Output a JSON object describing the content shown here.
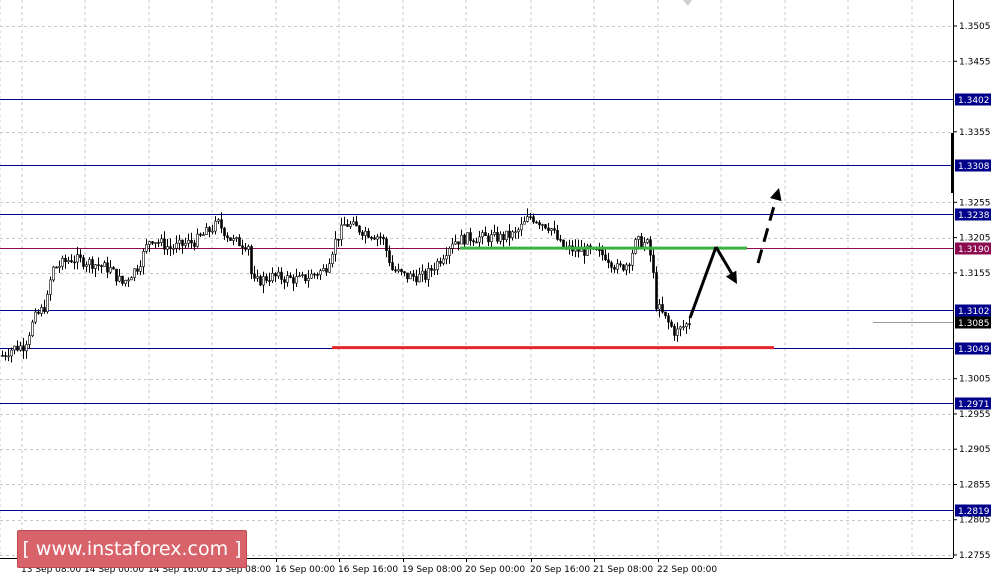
{
  "chart_data": {
    "type": "candlestick",
    "instrument_note": "",
    "y_axis": {
      "ylim": [
        1.2745,
        1.3525
      ],
      "ticks": [
        "1.3505",
        "1.3455",
        "1.3355",
        "1.3255",
        "1.3205",
        "1.3155",
        "1.3005",
        "1.2955",
        "1.2905",
        "1.2855",
        "1.2805",
        "1.2755"
      ]
    },
    "x_axis": {
      "labels": [
        "13 Sep 08:00",
        "14 Sep 00:00",
        "14 Sep 16:00",
        "15 Sep 08:00",
        "16 Sep 00:00",
        "16 Sep 16:00",
        "19 Sep 08:00",
        "20 Sep 00:00",
        "20 Sep 16:00",
        "21 Sep 08:00",
        "22 Sep 00:00"
      ]
    },
    "levels": [
      {
        "value": 1.3402,
        "label": "1.3402",
        "color": "#00008b"
      },
      {
        "value": 1.3308,
        "label": "1.3308",
        "color": "#00008b"
      },
      {
        "value": 1.3238,
        "label": "1.3238",
        "color": "#00008b"
      },
      {
        "value": 1.319,
        "label": "1.3190",
        "color": "#8b0a50"
      },
      {
        "value": 1.3102,
        "label": "1.3102",
        "color": "#00008b"
      },
      {
        "value": 1.3085,
        "label": "1.3085",
        "color": "#000000",
        "kind": "current-price"
      },
      {
        "value": 1.3049,
        "label": "1.3049",
        "color": "#00008b"
      },
      {
        "value": 1.2971,
        "label": "1.2971",
        "color": "#00008b"
      },
      {
        "value": 1.2819,
        "label": "1.2819",
        "color": "#00008b"
      }
    ],
    "segments": [
      {
        "name": "resistance-green",
        "value": 1.319,
        "color": "#3cb043"
      },
      {
        "name": "support-red",
        "value": 1.3049,
        "color": "#e8262e"
      }
    ],
    "grid": true,
    "legend": "none"
  },
  "watermark": {
    "text": "[ www.instaforex.com ]"
  }
}
